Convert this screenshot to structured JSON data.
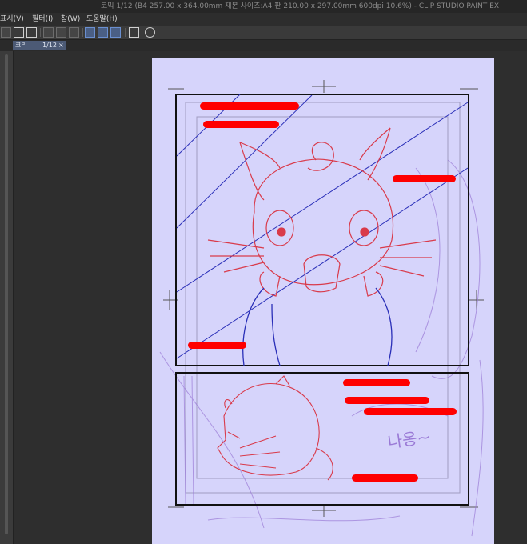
{
  "window": {
    "title": "코믹 1/12 (B4 257.00 x 364.00mm 재본 사이즈:A4 판 210.00 x 297.00mm 600dpi 10.6%) - CLIP STUDIO PAINT EX"
  },
  "menu": {
    "items": [
      "표시(V)",
      "필터(I)",
      "창(W)",
      "도움말(H)"
    ]
  },
  "tab": {
    "label": "코믹",
    "page": "1/12",
    "close": "×"
  },
  "canvas": {
    "handwriting": "나옹~",
    "redacted_bars": 8
  },
  "colors": {
    "paper": "#d6d4fb",
    "redaction": "#ff0000",
    "sketch_red": "#d93a4a",
    "sketch_blue": "#2a2fb8",
    "sketch_purple": "#9a7ad6"
  }
}
